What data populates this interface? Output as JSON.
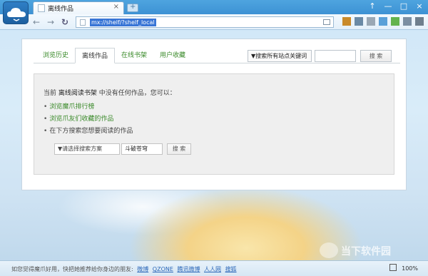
{
  "tab": {
    "title": "离线作品",
    "close": "×"
  },
  "newtab_glyph": "+",
  "window_buttons": [
    "↑",
    "—",
    "□",
    "×"
  ],
  "nav": {
    "back": "←",
    "forward": "→",
    "refresh": "↻"
  },
  "address": {
    "url": "mx://shelf/?shelf_local"
  },
  "content_tabs": [
    "浏览历史",
    "离线作品",
    "在线书架",
    "用户收藏"
  ],
  "active_tab_index": 1,
  "search": {
    "scope_label": "▼搜索所有站点关键词",
    "button": "搜 索"
  },
  "panel": {
    "message_prefix": "当前",
    "message_bold": "离线阅读书架",
    "message_suffix": "中没有任何作品，您可以：",
    "options": [
      "浏览魔爪排行榜",
      "浏览爪友们收藏的作品",
      "在下方搜索您想要阅读的作品"
    ],
    "plan_select": "▼请选择搜索方案",
    "keyword_value": "斗破苍穹",
    "go_button": "搜 索"
  },
  "status": {
    "promo": "如您觉得魔爪好用，快把她推荐给你身边的朋友:",
    "links": [
      "微博",
      "QZONE",
      "腾讯微博",
      "人人网",
      "搜狐"
    ],
    "zoom": "100%"
  },
  "watermark": "当下软件园",
  "colors": {
    "link_green": "#3a8a2a",
    "title_blue": "#3d92d4"
  }
}
